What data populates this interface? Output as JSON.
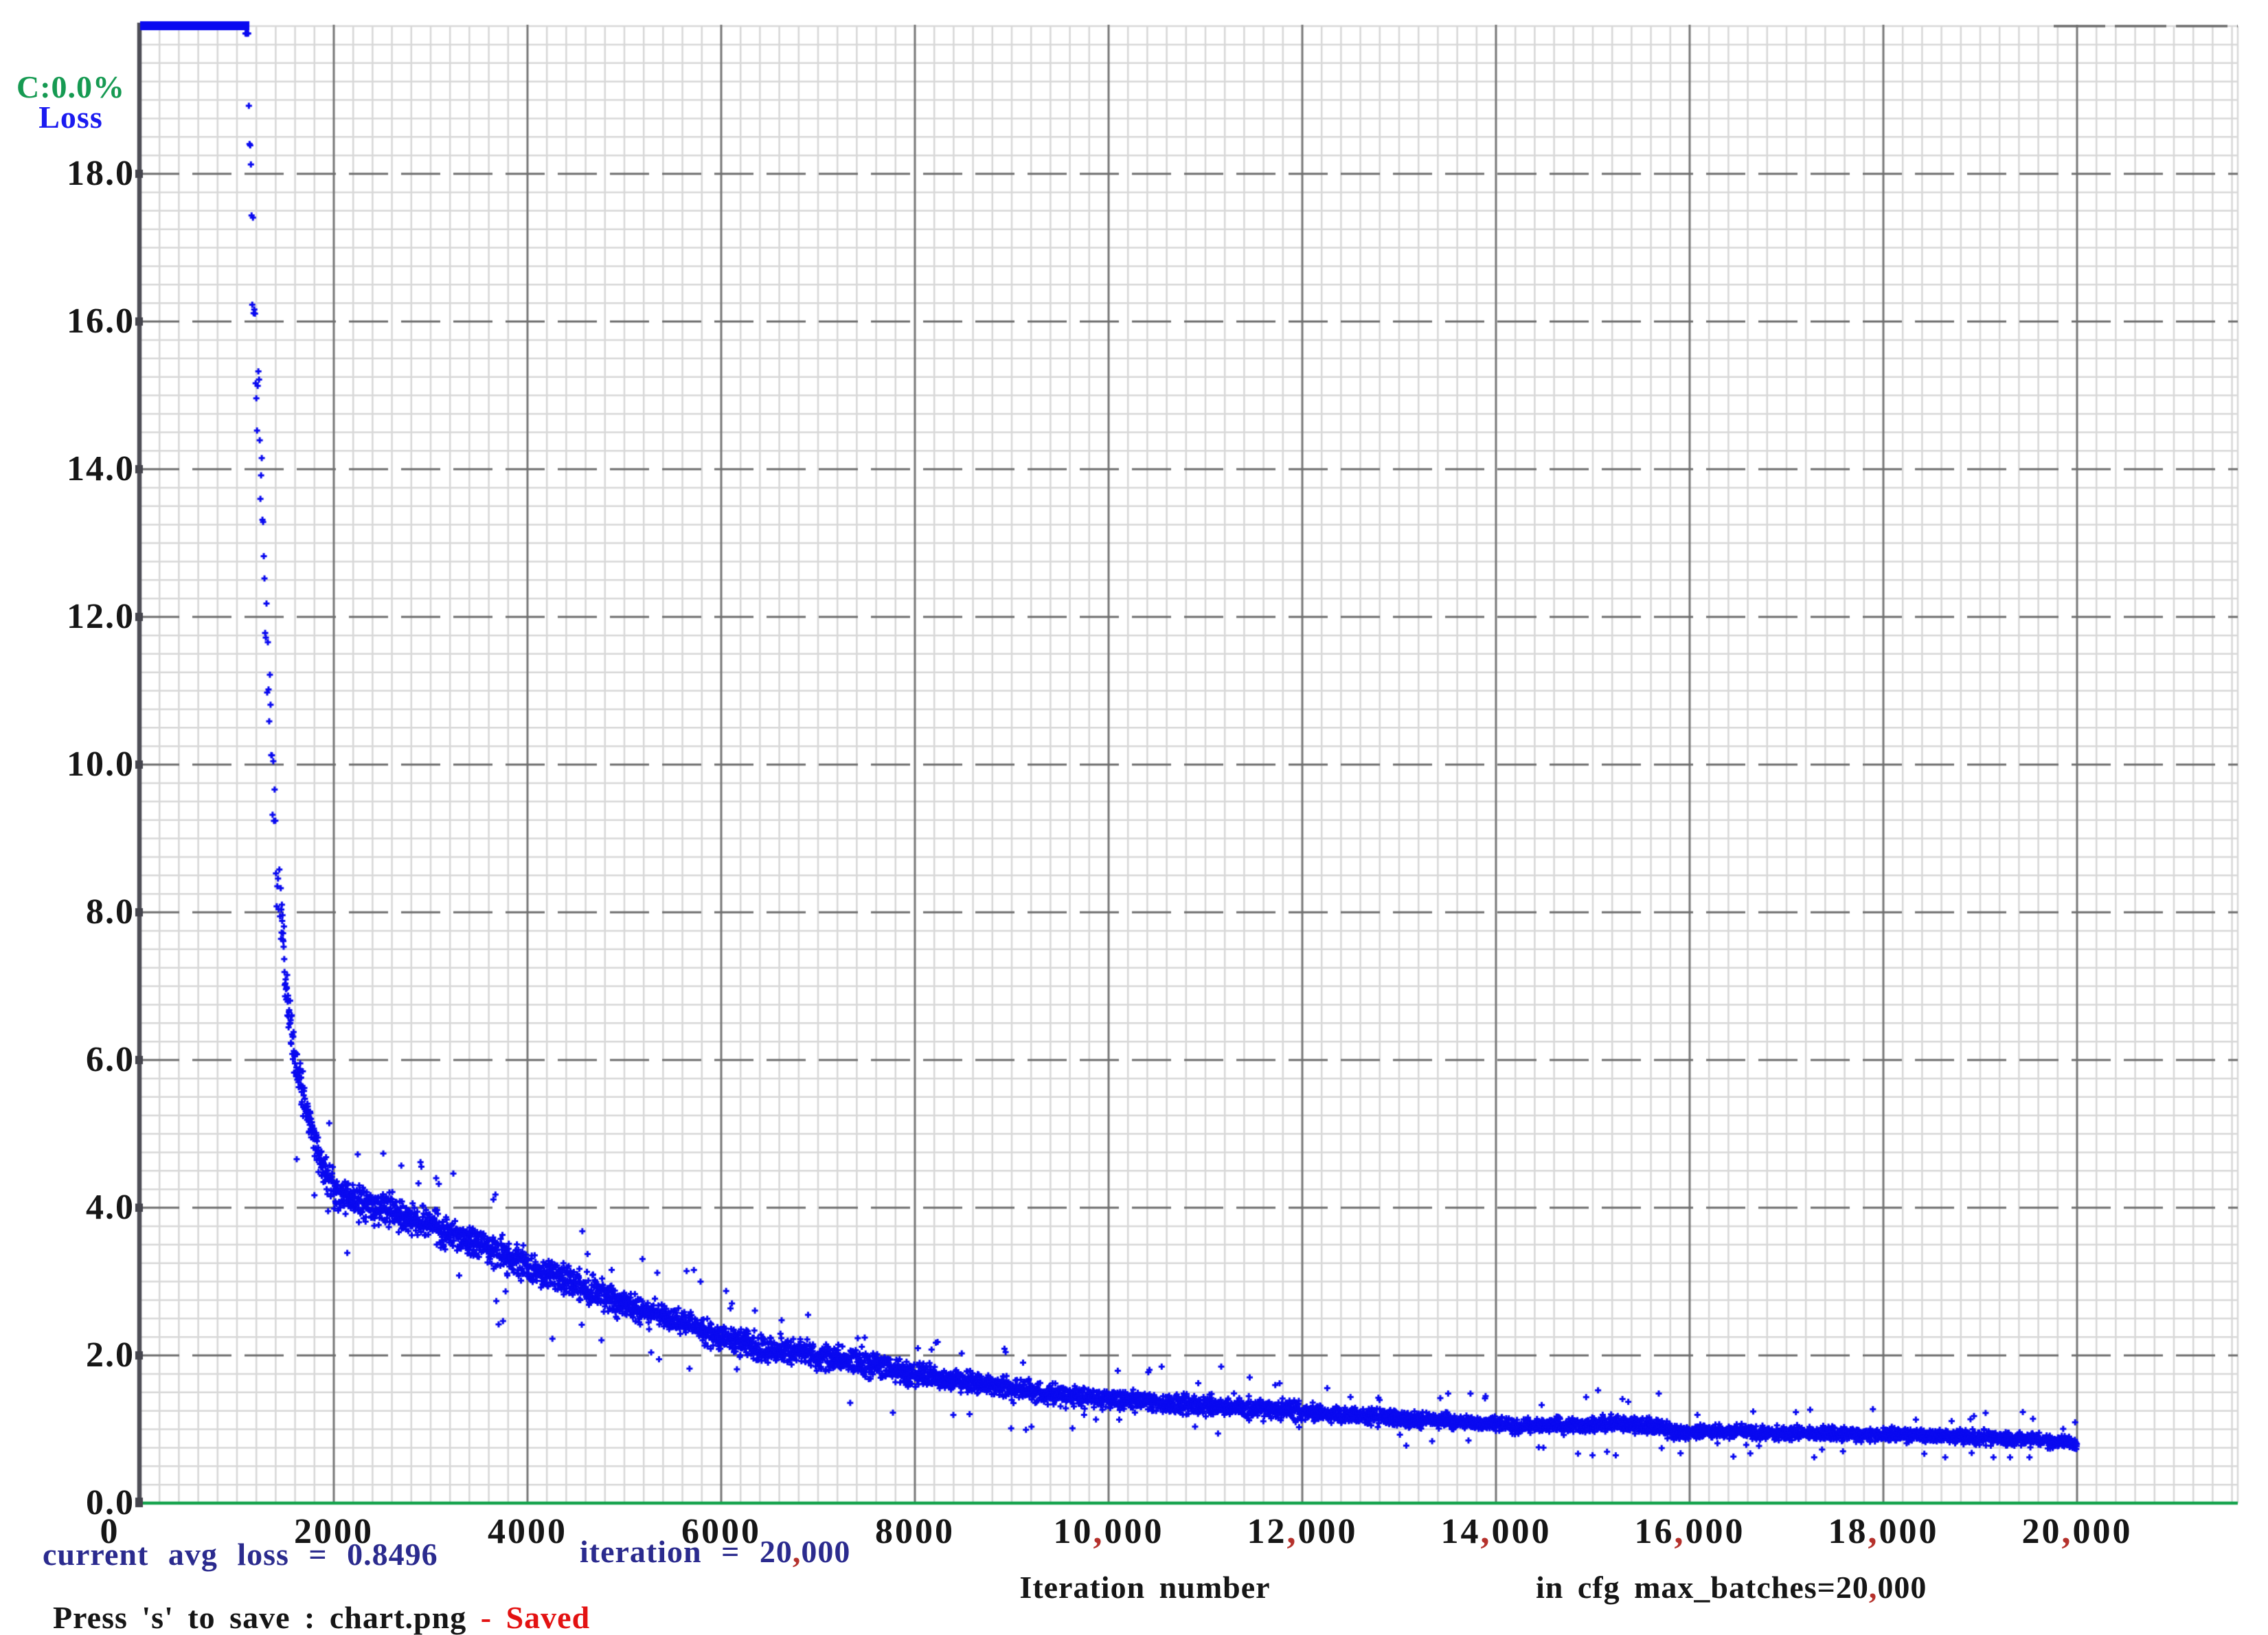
{
  "header": {
    "class_label": "C:0.0%",
    "loss_label": "Loss"
  },
  "captions": {
    "avg_loss": "current avg loss = 0.8496",
    "iteration": "iteration = 20,000",
    "save_hint": "Press 's' to save : chart.png",
    "save_sep": " - ",
    "saved": "Saved",
    "xaxis_title": "Iteration number",
    "max_batches": "in cfg max_batches=20,000"
  },
  "colors": {
    "point_blue": "#0a0af0",
    "clip_bar_blue": "#0a0af0",
    "loss_label_blue": "#1b1bf0",
    "class_label_green": "#169a52",
    "baseline_green": "#13a24b",
    "navy_text": "#2b2b8e",
    "saved_red": "#e31212",
    "black_text": "#161616",
    "comma_red": "#b5312c",
    "grid_minor": "#d8d8d8",
    "grid_major": "#787878",
    "grid_dashed": "#6e6e6e",
    "axis_dark": "#4e4e56"
  },
  "chart_data": {
    "type": "scatter",
    "title": "Loss",
    "xlabel": "Iteration number",
    "ylabel": "Loss",
    "xlim": [
      0,
      21700
    ],
    "ylim": [
      0,
      20
    ],
    "grid": {
      "minor_x_step": 200,
      "minor_y_step": 0.25,
      "major_x_step": 2000,
      "major_y_step": 2,
      "major_horizontal_style": "dashed",
      "baseline_color": "green"
    },
    "x_ticks": [
      "0",
      "2000",
      "4000",
      "6000",
      "8000",
      "10,000",
      "12,000",
      "14,000",
      "16,000",
      "18,000",
      "20,000"
    ],
    "x_tick_values": [
      0,
      2000,
      4000,
      6000,
      8000,
      10000,
      12000,
      14000,
      16000,
      18000,
      20000
    ],
    "y_ticks": [
      "0.0",
      "2.0",
      "4.0",
      "6.0",
      "8.0",
      "10.0",
      "12.0",
      "14.0",
      "16.0",
      "18.0"
    ],
    "y_tick_values": [
      0,
      2,
      4,
      6,
      8,
      10,
      12,
      14,
      16,
      18
    ],
    "current_avg_loss": 0.8496,
    "iteration": 20000,
    "max_batches": 20000,
    "series": [
      {
        "name": "Loss",
        "marker": "plus",
        "clip_bar": {
          "x_start": 0,
          "x_end": 1100,
          "value": 20,
          "note": "off-scale loss clipped at chart top"
        },
        "anchors": [
          [
            1100,
            21
          ],
          [
            1150,
            17.5
          ],
          [
            1200,
            15.3
          ],
          [
            1250,
            13.8
          ],
          [
            1300,
            12.0
          ],
          [
            1350,
            10.4
          ],
          [
            1400,
            9.0
          ],
          [
            1450,
            8.0
          ],
          [
            1500,
            7.0
          ],
          [
            1550,
            6.5
          ],
          [
            1600,
            6.0
          ],
          [
            1700,
            5.4
          ],
          [
            1800,
            4.9
          ],
          [
            1900,
            4.5
          ],
          [
            2000,
            4.25
          ],
          [
            2200,
            4.1
          ],
          [
            2400,
            4.0
          ],
          [
            2600,
            3.95
          ],
          [
            2800,
            3.85
          ],
          [
            3000,
            3.8
          ],
          [
            3300,
            3.6
          ],
          [
            3600,
            3.45
          ],
          [
            4000,
            3.2
          ],
          [
            4400,
            3.0
          ],
          [
            4800,
            2.8
          ],
          [
            5200,
            2.6
          ],
          [
            5600,
            2.45
          ],
          [
            6000,
            2.25
          ],
          [
            6400,
            2.1
          ],
          [
            6800,
            2.05
          ],
          [
            7200,
            1.95
          ],
          [
            7600,
            1.85
          ],
          [
            8000,
            1.75
          ],
          [
            8500,
            1.65
          ],
          [
            9000,
            1.55
          ],
          [
            9500,
            1.47
          ],
          [
            10000,
            1.4
          ],
          [
            10600,
            1.35
          ],
          [
            11200,
            1.3
          ],
          [
            11800,
            1.26
          ],
          [
            12400,
            1.2
          ],
          [
            13000,
            1.15
          ],
          [
            13600,
            1.1
          ],
          [
            14200,
            1.05
          ],
          [
            14800,
            1.05
          ],
          [
            15200,
            1.08
          ],
          [
            15600,
            1.05
          ],
          [
            15900,
            0.95
          ],
          [
            16200,
            0.98
          ],
          [
            16800,
            0.95
          ],
          [
            17400,
            0.94
          ],
          [
            18000,
            0.93
          ],
          [
            18600,
            0.91
          ],
          [
            19200,
            0.88
          ],
          [
            19600,
            0.86
          ],
          [
            20000,
            0.8
          ]
        ],
        "noise_spread": [
          [
            1500,
            0.8
          ],
          [
            1700,
            0.45
          ],
          [
            2600,
            0.33
          ],
          [
            5200,
            0.3
          ],
          [
            8000,
            0.25
          ],
          [
            12000,
            0.19
          ],
          [
            16000,
            0.15
          ],
          [
            20001,
            0.13
          ]
        ]
      }
    ]
  }
}
